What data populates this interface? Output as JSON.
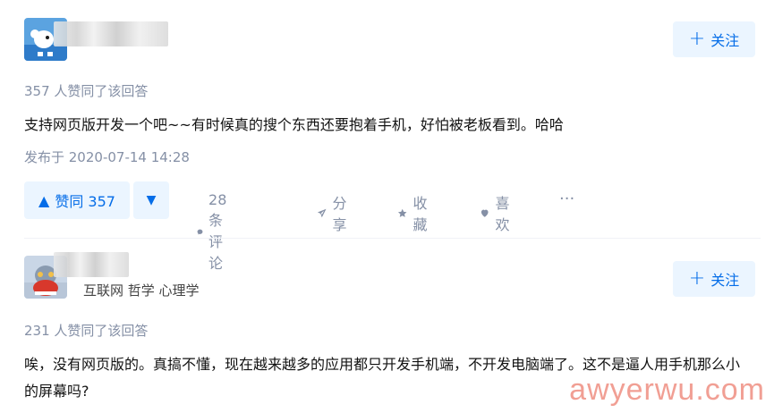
{
  "answers": [
    {
      "author_tags": "",
      "follow_label": "关注",
      "votes_text": "357 人赞同了该回答",
      "content": "支持网页版开发一个吧~~有时候真的搜个东西还要抱着手机，好怕被老板看到。哈哈",
      "date": "发布于 2020-07-14 14:28",
      "actions": {
        "vote_up": "赞同 357",
        "comment": "28 条评论",
        "share": "分享",
        "collect": "收藏",
        "like": "喜欢",
        "more": "···"
      }
    },
    {
      "author_tags": "互联网 哲学 心理学",
      "follow_label": "关注",
      "votes_text": "231 人赞同了该回答",
      "content": "唉，没有网页版的。真搞不懂，现在越来越多的应用都只开发手机端，不开发电脑端了。这不是逼人用手机那么小的屏幕吗?"
    }
  ],
  "watermark": "awyerwu.com",
  "colors": {
    "accent": "#056de8",
    "accent_bg": "#ebf5ff",
    "muted": "#8590a6"
  }
}
